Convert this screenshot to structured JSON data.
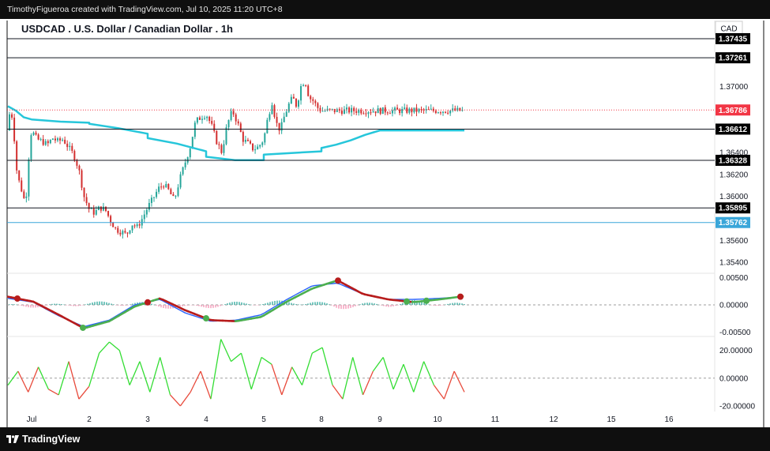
{
  "header": {
    "watermark": "TimothyFigueroa created with TradingView.com, Jul 10, 2025 11:20 UTC+8"
  },
  "footer": {
    "brand": "TradingView"
  },
  "colors": {
    "panel_bg": "#ffffff",
    "frame": "#0f0f0f",
    "candle_up": "#26a69a",
    "candle_down": "#d32f2f",
    "ma_line": "#26c6da",
    "current_price": "#f23645",
    "level_line": "#131722",
    "blue_level": "#3aa6d9",
    "macd_blue": "#2962ff",
    "macd_signal": "#b71c1c",
    "macd_signal_up": "#4caf50",
    "osc_up": "#33dd33",
    "osc_down": "#e84a3b"
  },
  "chart_data": [
    {
      "type": "candlestick",
      "title": "USDCAD . U.S. Dollar / Canadian Dollar . 1h",
      "currency": "CAD",
      "ylim": [
        1.353,
        1.376
      ],
      "y_ticks": [
        "1.37000",
        "1.36400",
        "1.36200",
        "1.36000",
        "1.35600",
        "1.35400"
      ],
      "x_ticks": [
        "Jul",
        "2",
        "3",
        "4",
        "5",
        "8",
        "9",
        "10",
        "11",
        "12",
        "15",
        "16"
      ],
      "current_price": 1.36786,
      "horizontal_levels": [
        {
          "label": "1.37435",
          "value": 1.37435,
          "style": "dark"
        },
        {
          "label": "1.37261",
          "value": 1.37261,
          "style": "dark"
        },
        {
          "label": "1.36612",
          "value": 1.36612,
          "style": "dark"
        },
        {
          "label": "1.36328",
          "value": 1.36328,
          "style": "dark"
        },
        {
          "label": "1.35895",
          "value": 1.35895,
          "style": "dark"
        },
        {
          "label": "1.35762",
          "value": 1.35762,
          "style": "blue"
        }
      ],
      "price_path": [
        [
          1.366,
          1.368,
          1.3672,
          1.3652,
          1.3625,
          1.3615,
          1.3608,
          1.3602,
          1.3593,
          1.361,
          1.3648,
          1.366
        ],
        [
          1.366,
          1.3652,
          1.365,
          1.3647,
          1.3653,
          1.365,
          1.3652,
          1.3645,
          1.3638,
          1.3625,
          1.36,
          1.3588
        ],
        [
          1.3588,
          1.3585,
          1.359,
          1.3588,
          1.3578,
          1.357,
          1.3568,
          1.3565,
          1.3575,
          1.3572,
          1.358,
          1.359
        ],
        [
          1.359,
          1.3598,
          1.3607,
          1.3611,
          1.3605,
          1.3596,
          1.3615,
          1.363,
          1.3645,
          1.3668,
          1.3672,
          1.3675
        ],
        [
          1.3675,
          1.3665,
          1.365,
          1.364,
          1.3665,
          1.3678,
          1.3667,
          1.3652,
          1.3648,
          1.3643,
          1.3645,
          1.3652
        ],
        [
          1.3652,
          1.3672,
          1.3686,
          1.3667,
          1.366,
          1.3673,
          1.3683,
          1.369,
          1.3682,
          1.37,
          1.3706,
          1.369,
          1.3687,
          1.3681,
          1.3678
        ]
      ],
      "ma_series": [
        [
          1.3682,
          1.3678,
          1.3672,
          1.367
        ],
        [
          1.367,
          1.3668,
          1.3667
        ],
        [
          1.3666,
          1.3662,
          1.3657
        ],
        [
          1.3653,
          1.3648,
          1.3641
        ],
        [
          1.3636,
          1.3633,
          1.3633
        ],
        [
          1.3638,
          1.3641
        ],
        [
          1.3644,
          1.3647,
          1.3651,
          1.3656,
          1.366
        ]
      ]
    },
    {
      "type": "line",
      "name": "macd",
      "y_ticks": [
        "0.00500",
        "0.00000",
        "-0.00500"
      ],
      "ylim": [
        -0.0058,
        0.0058
      ],
      "macd": [
        0.0012,
        0.0005,
        -0.002,
        -0.004,
        -0.0028,
        0.0,
        0.001,
        -0.0015,
        -0.003,
        -0.0028,
        -0.0018,
        0.001,
        0.0035,
        0.004,
        0.002,
        0.001,
        0.001,
        0.0012,
        0.0015
      ],
      "signal": [
        0.0015,
        0.0006,
        -0.0018,
        -0.0043,
        -0.003,
        -0.0003,
        0.0012,
        -0.001,
        -0.0028,
        -0.003,
        -0.0022,
        0.0006,
        0.003,
        0.0045,
        0.002,
        0.001,
        0.0005,
        0.001,
        0.0016
      ],
      "histogram_max": 0.0012
    },
    {
      "type": "line",
      "name": "oscillator",
      "y_ticks": [
        "20.00000",
        "0.00000",
        "-20.00000"
      ],
      "ylim": [
        -24,
        30
      ],
      "values": [
        -5,
        5,
        -10,
        8,
        -8,
        -12,
        12,
        -15,
        -6,
        18,
        26,
        20,
        -5,
        12,
        -10,
        15,
        -12,
        -20,
        -10,
        5,
        -15,
        28,
        12,
        18,
        -8,
        15,
        10,
        -12,
        8,
        -5,
        18,
        22,
        -5,
        -15,
        15,
        -12,
        5,
        15,
        -8,
        10,
        -10,
        12,
        -5,
        -15,
        5,
        -10
      ]
    }
  ]
}
